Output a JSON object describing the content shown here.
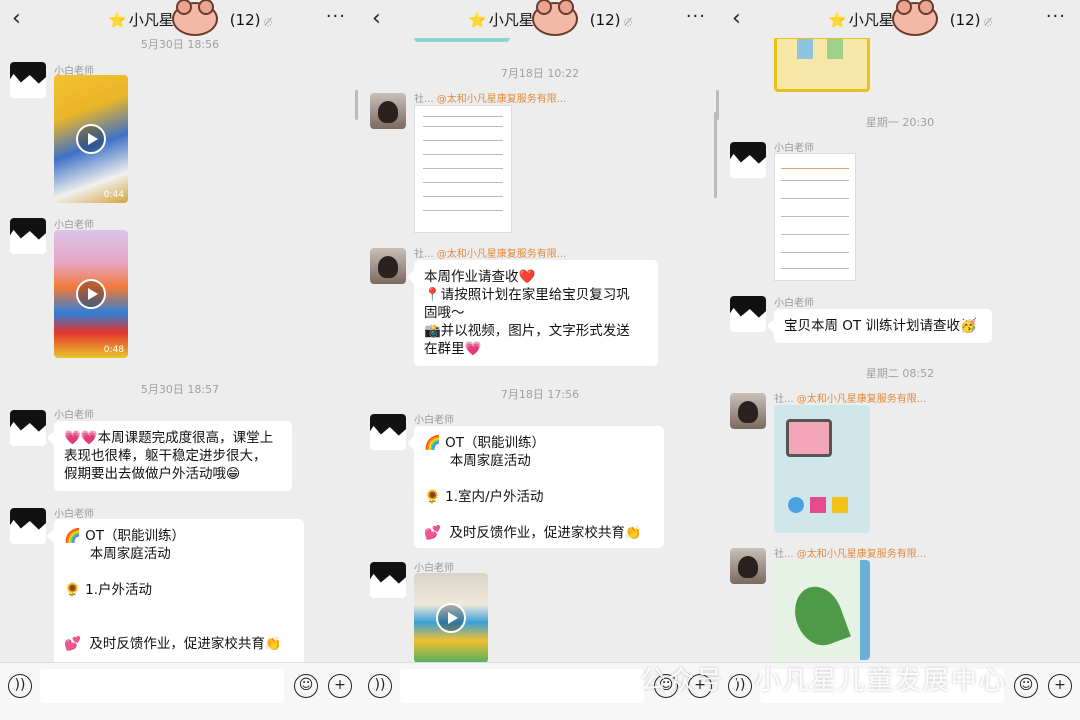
{
  "header": {
    "back": "‹",
    "star": "⭐",
    "title_a": "小凡星",
    "title_b": "(12)",
    "more": "···",
    "mute": "🔔̸"
  },
  "panel1": {
    "time1": "5月30日 18:56",
    "time2": "5月30日 18:57",
    "sender": "小白老师",
    "video1_dur": "0:44",
    "video2_dur": "0:48",
    "msg1": "💗💗本周课题完成度很高，课堂上\n表现也很棒，躯干稳定进步很大，\n假期要出去做做户外活动哦😁",
    "msg2": "🌈 OT（职能训练）\n      本周家庭活动\n\n🌻 1.户外活动\n\n\n💕  及时反馈作业，促进家校共育👏"
  },
  "panel2": {
    "time1": "7月18日 10:22",
    "time2": "7月18日 17:56",
    "sender_short": "社...",
    "sender_org": "@太和小凡星康复服务有限...",
    "sender2": "小白老师",
    "msg1": "本周作业请查收❤️\n📍请按照计划在家里给宝贝复习巩\n固哦～\n📸并以视频，图片，文字形式发送\n在群里💗",
    "msg2": "🌈 OT（职能训练）\n      本周家庭活动\n\n🌻 1.室内/户外活动\n\n💕  及时反馈作业，促进家校共育👏"
  },
  "panel3": {
    "time1": "星期一 20:30",
    "time2": "星期二 08:52",
    "sender": "小白老师",
    "sender_short": "社...",
    "sender_org": "@太和小凡星康复服务有限...",
    "msg1": "宝贝本周 OT 训练计划请查收🥳"
  },
  "bottom": {
    "voice": "))",
    "emoji": "☺",
    "plus": "+"
  },
  "watermark": "公众号 · 小凡星儿童发展中心"
}
